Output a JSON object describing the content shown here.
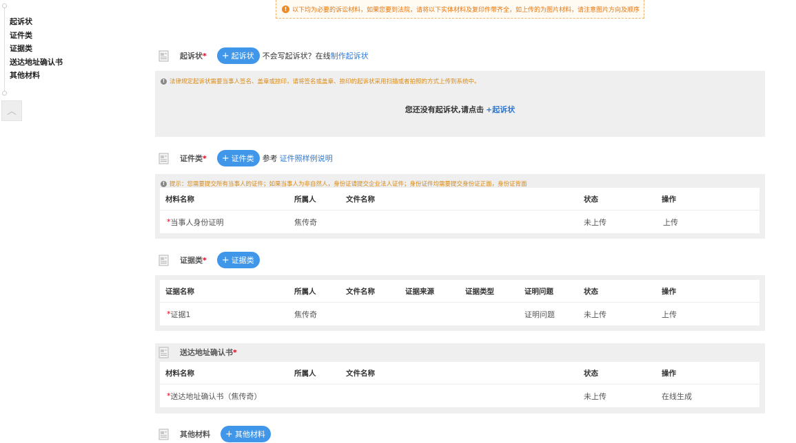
{
  "nav": {
    "items": [
      "起诉状",
      "证件类",
      "证据类",
      "送达地址确认书",
      "其他材料"
    ]
  },
  "back_top_glyph": "︿",
  "top_notice": "以下均为必要的诉讼材料，如果您要到法院，请将以下实体材料及复印件带齐全，如上传的为图片材料，请注意图片方向及顺序",
  "sections": {
    "complaint": {
      "title": "起诉状",
      "required": "*",
      "button": "起诉状",
      "after_text": "不会写起诉状？在线",
      "link": "制作起诉状",
      "tip": "法律规定起诉状需要当事人签名、盖章或捺印，请将签名或盖章、捺印的起诉状采用扫描或者拍照的方式上传到系统中。",
      "empty_text": "您还没有起诉状,请点击",
      "empty_link": "+起诉状"
    },
    "id_docs": {
      "title": "证件类",
      "required": "*",
      "button": "证件类",
      "after_text": "参考",
      "link": "证件照样例说明",
      "tip": "提示：您需要提交所有当事人的证件；如果当事人为非自然人，身份证请提交企业法人证件；身份证件均需要提交身份证正面，身份证背面",
      "headers": [
        "材料名称",
        "所属人",
        "文件名称",
        "状态",
        "操作"
      ],
      "rows": [
        {
          "name": "当事人身份证明",
          "owner": "焦传奇",
          "file": "",
          "status": "未上传",
          "action": "上传"
        }
      ]
    },
    "evidence": {
      "title": "证据类",
      "required": "*",
      "button": "证据类",
      "headers": [
        "证据名称",
        "所属人",
        "文件名称",
        "证据来源",
        "证据类型",
        "证明问题",
        "状态",
        "操作"
      ],
      "rows": [
        {
          "name": "证据1",
          "owner": "焦传奇",
          "file": "",
          "source": "",
          "type": "",
          "issue": "证明问题",
          "status": "未上传",
          "action": "上传"
        }
      ]
    },
    "address": {
      "title": "送达地址确认书",
      "required": "*",
      "headers": [
        "材料名称",
        "所属人",
        "文件名称",
        "状态",
        "操作"
      ],
      "rows": [
        {
          "name": "送达地址确认书（焦传奇）",
          "owner": "",
          "file": "",
          "status": "未上传",
          "action": "在线生成"
        }
      ]
    },
    "other": {
      "title": "其他材料",
      "button": "其他材料"
    }
  },
  "row_required_mark": "*",
  "plus_glyph": "+",
  "colors": {
    "accent": "#4097e9",
    "warning": "#e6750e",
    "danger": "#d9001b",
    "link": "#2f79d4",
    "panel_bg": "#efefef"
  }
}
